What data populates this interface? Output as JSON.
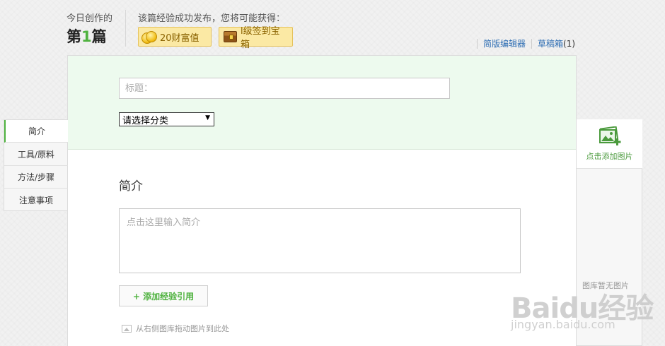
{
  "header": {
    "today_label": "今日创作的",
    "count_prefix": "第",
    "count_num": "1",
    "count_suffix": "篇",
    "reward_label": "该篇经验成功发布，您将可能获得：",
    "badges": [
      {
        "icon": "coins-icon",
        "label": "20财富值"
      },
      {
        "icon": "treasure-chest-icon",
        "label": "l级签到宝箱"
      }
    ],
    "links": {
      "simple_editor": "简版编辑器",
      "drafts": "草稿箱",
      "drafts_count": "(1)"
    }
  },
  "form": {
    "title_placeholder": "标题：",
    "category_selected": "请选择分类"
  },
  "nav": {
    "items": [
      {
        "label": "简介",
        "active": true
      },
      {
        "label": "工具/原料",
        "active": false
      },
      {
        "label": "方法/步骤",
        "active": false
      },
      {
        "label": "注意事项",
        "active": false
      }
    ]
  },
  "intro": {
    "title": "简介",
    "placeholder": "点击这里输入简介",
    "add_reference": "+ 添加经验引用",
    "drag_hint": "从右侧图库拖动图片到此处"
  },
  "gallery": {
    "add_label": "点击添加图片",
    "empty_text": "图库暂无图片"
  },
  "watermark": {
    "logo": "Baidu经验",
    "url": "jingyan.baidu.com"
  },
  "colors": {
    "accent_green": "#4fb23f",
    "link_blue": "#2d6db3",
    "badge_bg": "#fbe9a4",
    "panel_green": "#edfaee"
  }
}
